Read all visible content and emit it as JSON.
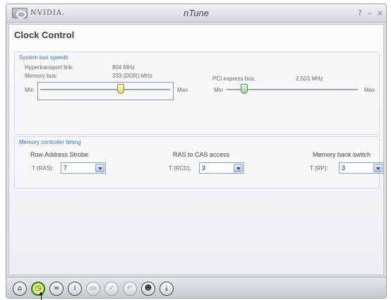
{
  "titlebar": {
    "brand": "NVIDIA.",
    "app_title": "nTune",
    "help_label": "?",
    "minimize_label": "–",
    "close_label": "×"
  },
  "page_title": "Clock Control",
  "system_bus": {
    "title": "System bus speeds",
    "hypertransport_label": "Hypertransport link:",
    "hypertransport_value": "804 MHz",
    "memory_bus_label": "Memory bus:",
    "memory_bus_value": "333 (DDR) MHz",
    "memory_slider": {
      "min_label": "Min",
      "max_label": "Max",
      "level": 0.62
    },
    "pci_label": "PCI express bus:",
    "pci_value": "2,503 MHz",
    "pci_slider": {
      "min_label": "Min",
      "max_label": "Max",
      "level": 0.0
    }
  },
  "memory_timing": {
    "title": "Memory controller timing",
    "ras": {
      "heading": "Row Address Strobe",
      "label": "T (RAS):",
      "value": "7"
    },
    "rcd": {
      "heading": "RAS to CAS access",
      "label": "T (RCD):",
      "value": "3"
    },
    "rp": {
      "heading": "Memory bank switch",
      "label": "T (RP):",
      "value": "3"
    }
  },
  "toolbar": {
    "buttons": [
      {
        "icon": "home-icon",
        "glyph": "⌂"
      },
      {
        "icon": "clock-control-icon",
        "glyph": "◷"
      },
      {
        "icon": "link-icon",
        "glyph": "∞"
      },
      {
        "icon": "info-icon",
        "glyph": "i"
      },
      {
        "icon": "ok-icon",
        "glyph": "OK"
      },
      {
        "icon": "check-icon",
        "glyph": "✓"
      },
      {
        "icon": "undo-icon",
        "glyph": "↶"
      },
      {
        "icon": "profile-icon",
        "glyph": "☻"
      },
      {
        "icon": "download-icon",
        "glyph": "⤓"
      }
    ]
  },
  "colors": {
    "accent": "#3d6fb5",
    "active_tool": "#c8e23a"
  }
}
